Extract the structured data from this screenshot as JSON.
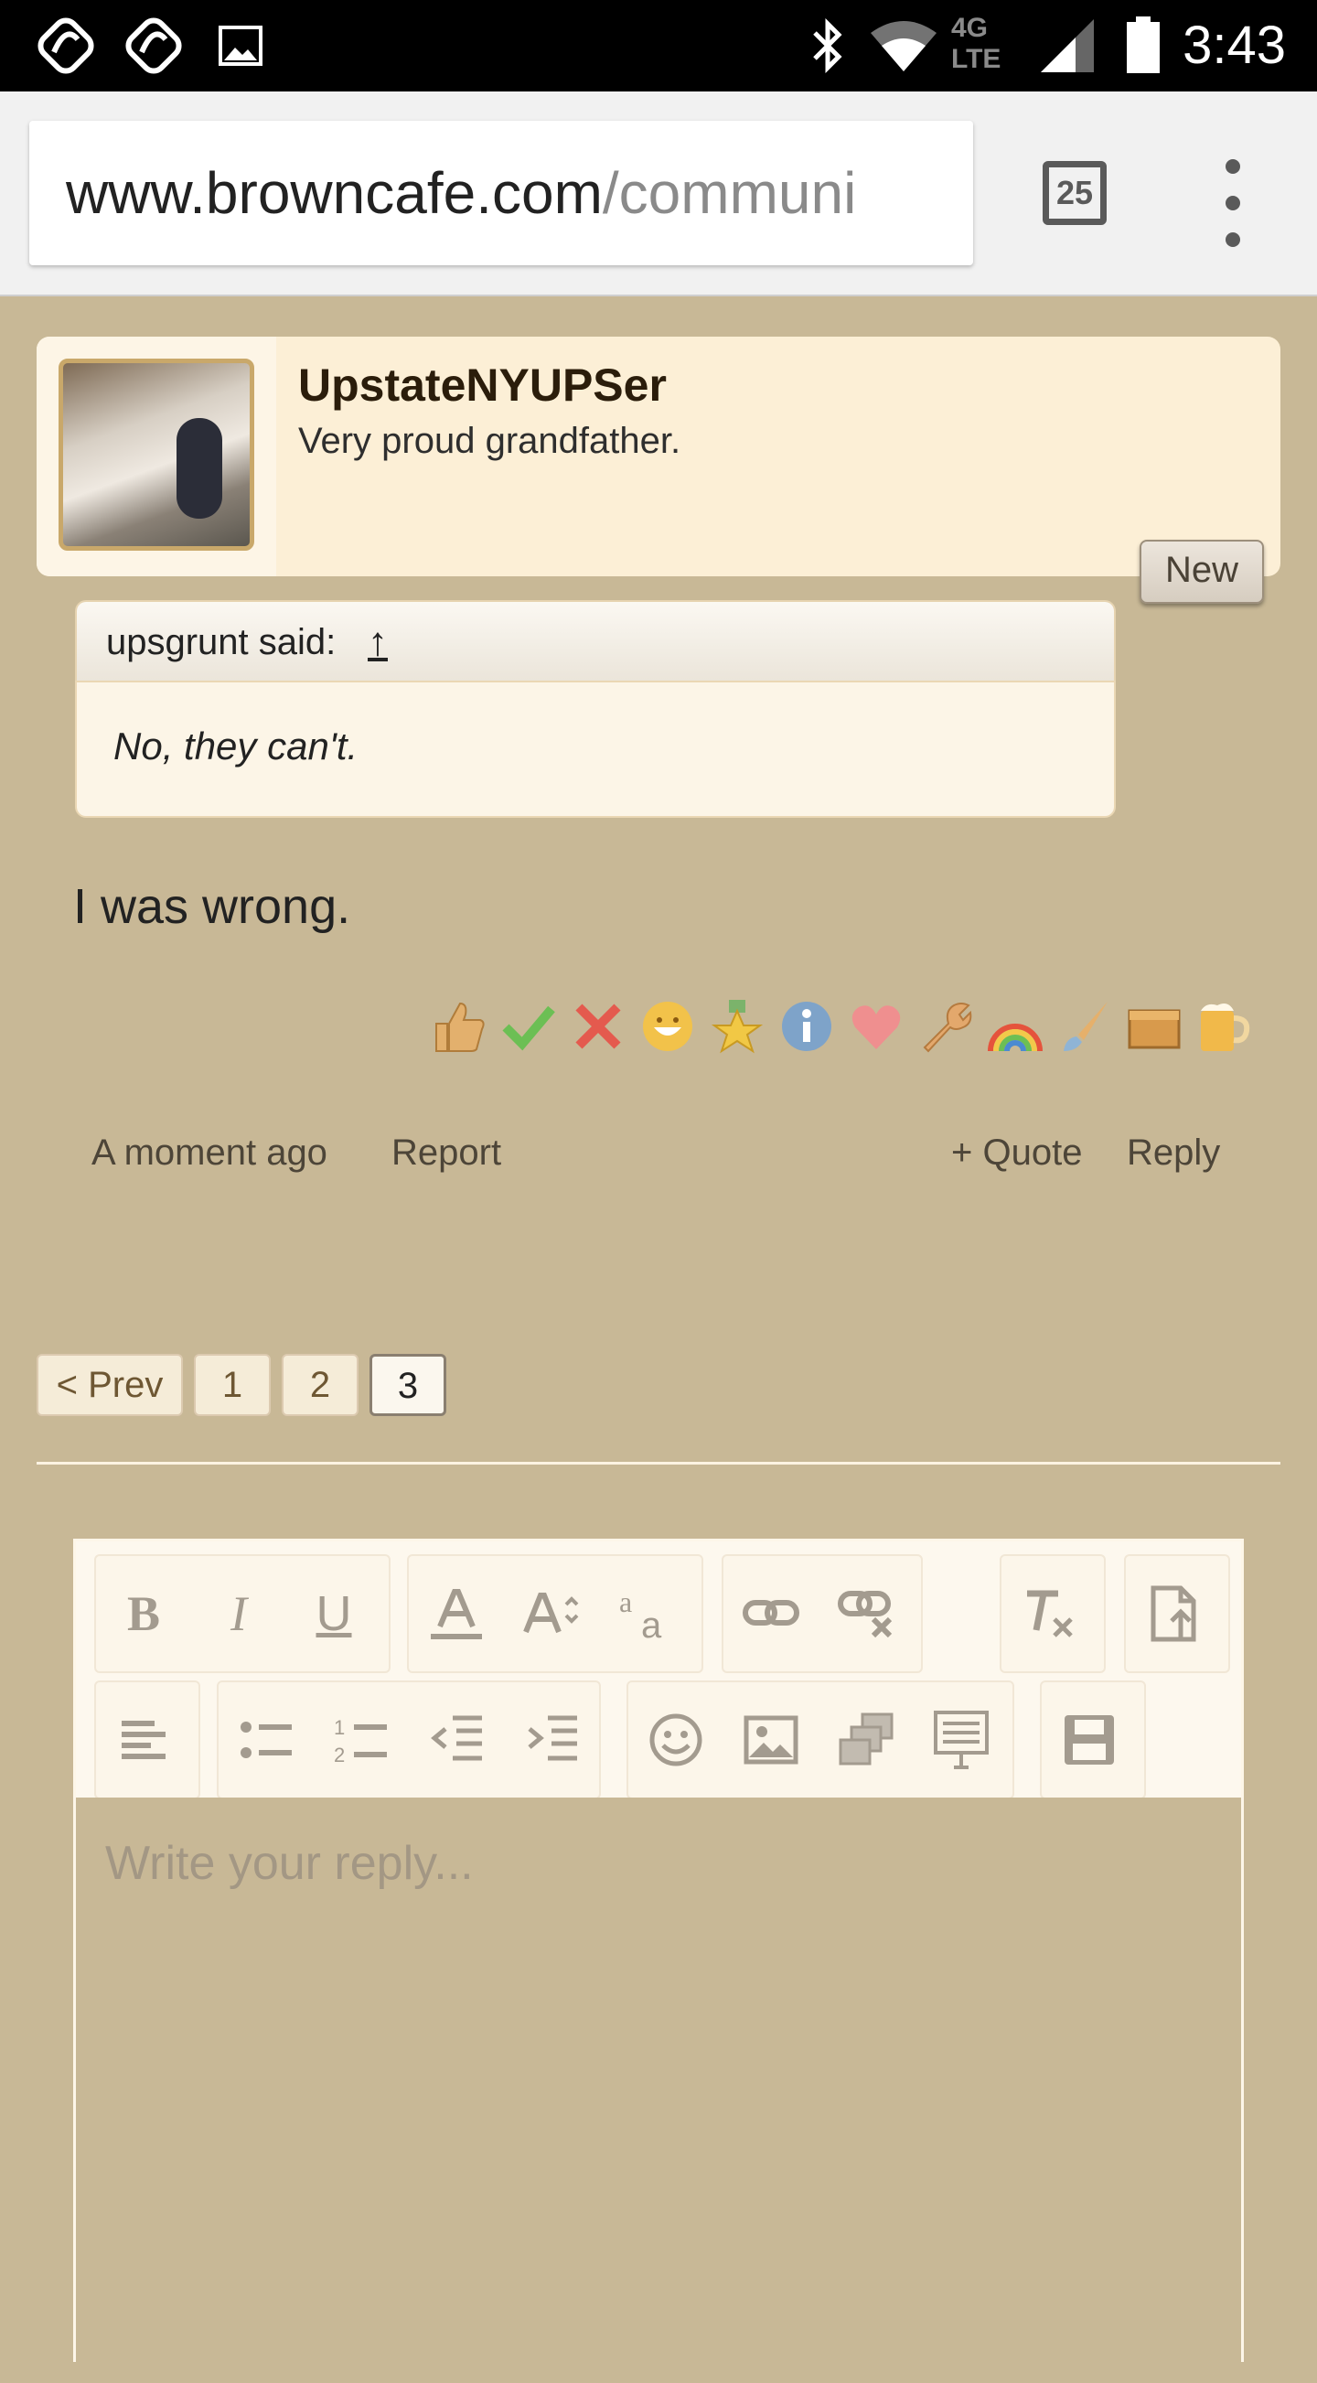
{
  "status_bar": {
    "time": "3:43",
    "network": "4G LTE"
  },
  "browser": {
    "url_domain": "www.browncafe.com",
    "url_path": "/communi",
    "tab_count": "25"
  },
  "post": {
    "username": "UpstateNYUPSer",
    "user_title": "Very proud grandfather.",
    "badge": "New",
    "quote": {
      "author": "upsgrunt said:",
      "arrow": "↑",
      "text": "No, they can't."
    },
    "message": "I was wrong.",
    "reactions": [
      "thumbs-up",
      "check",
      "x",
      "smile",
      "medal",
      "info",
      "heart",
      "wrench",
      "rainbow",
      "brush",
      "box",
      "beer"
    ],
    "time": "A moment ago",
    "report": "Report",
    "quote_btn": "+ Quote",
    "reply_btn": "Reply"
  },
  "pagination": {
    "prev": "< Prev",
    "pages": [
      "1",
      "2",
      "3"
    ],
    "current": "3"
  },
  "editor": {
    "placeholder": "Write your reply...",
    "toolbar": {
      "bold": "B",
      "italic": "I",
      "underline": "U"
    }
  }
}
